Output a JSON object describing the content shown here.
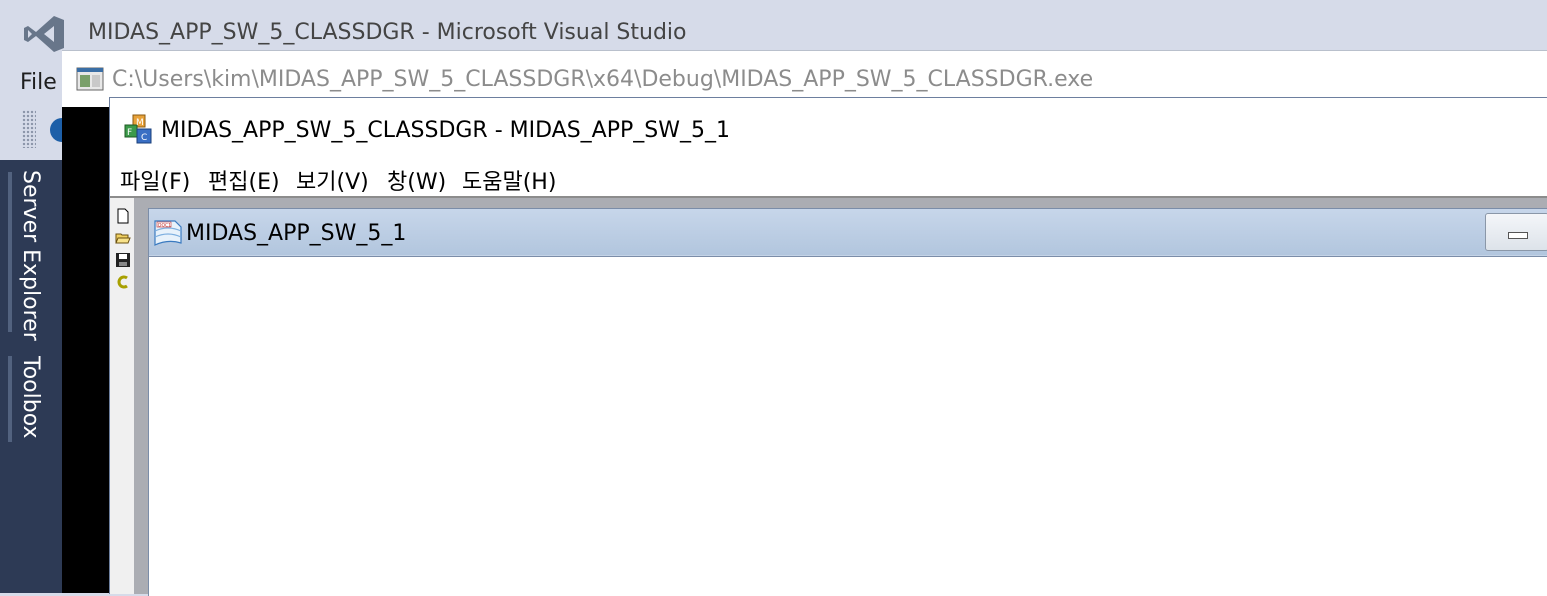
{
  "vs": {
    "window_title": "MIDAS_APP_SW_5_CLASSDGR - Microsoft Visual Studio",
    "menu_file": "File",
    "sidebar_tabs": [
      "Server Explorer",
      "Toolbox"
    ],
    "logo_icon": "visual-studio-logo",
    "accent_color": "#1d5fa8"
  },
  "console": {
    "title": "C:\\Users\\kim\\MIDAS_APP_SW_5_CLASSDGR\\x64\\Debug\\MIDAS_APP_SW_5_CLASSDGR.exe",
    "icon": "console-window-icon"
  },
  "app": {
    "title": "MIDAS_APP_SW_5_CLASSDGR - MIDAS_APP_SW_5_1",
    "icon": "mfc-app-icon",
    "menu": [
      "파일(F)",
      "편집(E)",
      "보기(V)",
      "창(W)",
      "도움말(H)"
    ],
    "toolbar": [
      "new-file-icon",
      "open-folder-icon",
      "save-icon",
      "undo-icon"
    ]
  },
  "child": {
    "title": "MIDAS_APP_SW_5_1",
    "icon": "document-icon",
    "minimize_icon": "minimize-icon"
  }
}
